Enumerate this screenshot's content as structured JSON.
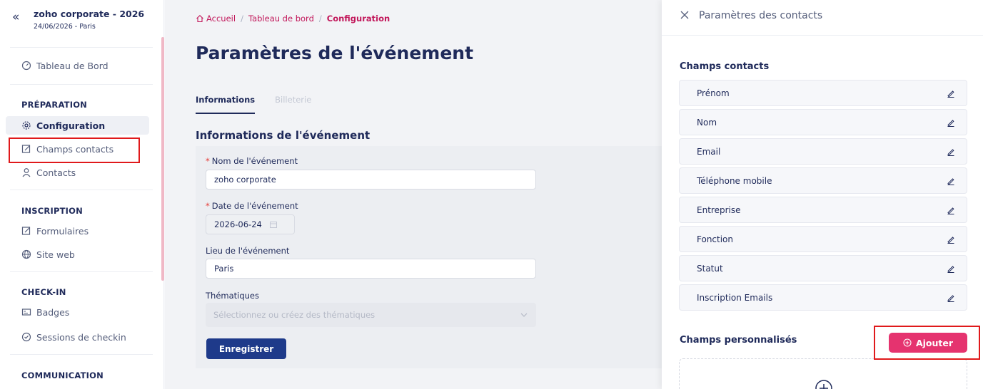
{
  "sidebar": {
    "collapse_icon": "«",
    "event_name": "zoho corporate - 2026",
    "event_meta": "24/06/2026 - Paris",
    "dashboard": "Tableau de Bord",
    "sections": {
      "preparation": "PRÉPARATION",
      "inscription": "INSCRIPTION",
      "checkin": "CHECK-IN",
      "communication": "COMMUNICATION"
    },
    "items": {
      "configuration": "Configuration",
      "champs_contacts": "Champs contacts",
      "contacts": "Contacts",
      "formulaires": "Formulaires",
      "site_web": "Site web",
      "badges": "Badges",
      "sessions": "Sessions de checkin"
    }
  },
  "breadcrumb": {
    "home": "Accueil",
    "dashboard": "Tableau de bord",
    "current": "Configuration",
    "separator": "/"
  },
  "main": {
    "title": "Paramètres de l'événement",
    "tabs": [
      "Informations",
      "Billeterie"
    ],
    "section_title": "Informations de l'événement",
    "fields": {
      "name_label": "Nom de l'événement",
      "name_value": "zoho corporate",
      "date_label": "Date de l'événement",
      "date_value": "2026-06-24",
      "place_label": "Lieu de l'événement",
      "place_value": "Paris",
      "themes_label": "Thématiques",
      "themes_placeholder": "Sélectionnez ou créez des thématiques",
      "required_mark": "*"
    },
    "save_button": "Enregistrer"
  },
  "drawer": {
    "title": "Paramètres des contacts",
    "contact_fields_title": "Champs contacts",
    "contact_fields": [
      "Prénom",
      "Nom",
      "Email",
      "Téléphone mobile",
      "Entreprise",
      "Fonction",
      "Statut",
      "Inscription Emails"
    ],
    "custom_fields_title": "Champs personnalisés",
    "add_button": "Ajouter"
  },
  "colors": {
    "accent_pink": "#e5336f",
    "primary_navy": "#1e3a8a",
    "highlight_red": "#e0191b"
  }
}
